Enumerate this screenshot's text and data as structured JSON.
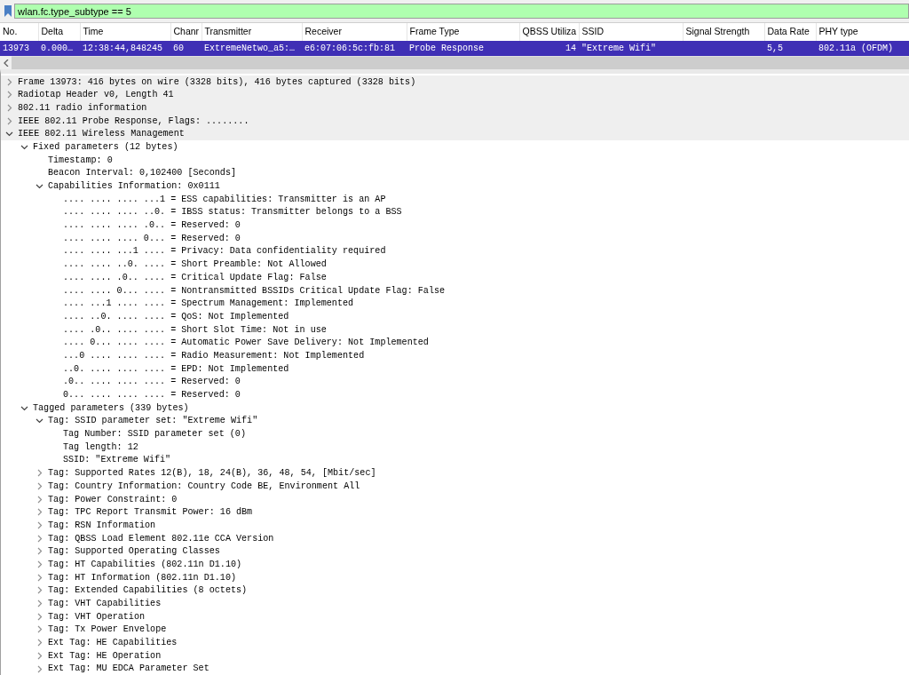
{
  "filter": {
    "value": "wlan.fc.type_subtype == 5"
  },
  "packet_list": {
    "columns": [
      {
        "label": "No.",
        "right_aligned": false
      },
      {
        "label": "Delta",
        "right_aligned": false
      },
      {
        "label": "Time",
        "right_aligned": false
      },
      {
        "label": "Chanr",
        "right_aligned": false
      },
      {
        "label": "Transmitter",
        "right_aligned": false
      },
      {
        "label": "Receiver",
        "right_aligned": false
      },
      {
        "label": "Frame Type",
        "right_aligned": false
      },
      {
        "label": "QBSS Utiliza",
        "right_aligned": true
      },
      {
        "label": "SSID",
        "right_aligned": false
      },
      {
        "label": "Signal Strength"
      },
      {
        "label": "Data Rate",
        "right_aligned": false
      },
      {
        "label": "PHY type",
        "right_aligned": false
      }
    ],
    "rows": [
      {
        "selected": true,
        "cells": [
          "13973",
          "0.000…",
          "12:38:44,848245",
          "60",
          "ExtremeNetwo_a5:…",
          "e6:07:06:5c:fb:81",
          "Probe Response",
          "14",
          "\"Extreme Wifi\"",
          "",
          "5,5",
          "802.11a (OFDM)"
        ]
      }
    ]
  },
  "details": [
    {
      "text": "Frame 13973: 416 bytes on wire (3328 bits), 416 bytes captured (3328 bits)",
      "expanded": false
    },
    {
      "text": "Radiotap Header v0, Length 41",
      "expanded": false
    },
    {
      "text": "802.11 radio information",
      "expanded": false
    },
    {
      "text": "IEEE 802.11 Probe Response, Flags: ........",
      "expanded": false
    },
    {
      "text": "IEEE 802.11 Wireless Management",
      "expanded": true,
      "children": [
        {
          "text": "Fixed parameters (12 bytes)",
          "expanded": true,
          "children": [
            {
              "text": "Timestamp: 0"
            },
            {
              "text": "Beacon Interval: 0,102400 [Seconds]"
            },
            {
              "text": "Capabilities Information: 0x0111",
              "expanded": true,
              "children": [
                {
                  "text": ".... .... .... ...1 = ESS capabilities: Transmitter is an AP"
                },
                {
                  "text": ".... .... .... ..0. = IBSS status: Transmitter belongs to a BSS"
                },
                {
                  "text": ".... .... .... .0.. = Reserved: 0"
                },
                {
                  "text": ".... .... .... 0... = Reserved: 0"
                },
                {
                  "text": ".... .... ...1 .... = Privacy: Data confidentiality required"
                },
                {
                  "text": ".... .... ..0. .... = Short Preamble: Not Allowed"
                },
                {
                  "text": ".... .... .0.. .... = Critical Update Flag: False"
                },
                {
                  "text": ".... .... 0... .... = Nontransmitted BSSIDs Critical Update Flag: False"
                },
                {
                  "text": ".... ...1 .... .... = Spectrum Management: Implemented"
                },
                {
                  "text": ".... ..0. .... .... = QoS: Not Implemented"
                },
                {
                  "text": ".... .0.. .... .... = Short Slot Time: Not in use"
                },
                {
                  "text": ".... 0... .... .... = Automatic Power Save Delivery: Not Implemented"
                },
                {
                  "text": "...0 .... .... .... = Radio Measurement: Not Implemented"
                },
                {
                  "text": "..0. .... .... .... = EPD: Not Implemented"
                },
                {
                  "text": ".0.. .... .... .... = Reserved: 0"
                },
                {
                  "text": "0... .... .... .... = Reserved: 0"
                }
              ]
            }
          ]
        },
        {
          "text": "Tagged parameters (339 bytes)",
          "expanded": true,
          "children": [
            {
              "text": "Tag: SSID parameter set: \"Extreme Wifi\"",
              "expanded": true,
              "children": [
                {
                  "text": "Tag Number: SSID parameter set (0)"
                },
                {
                  "text": "Tag length: 12"
                },
                {
                  "text": "SSID: \"Extreme Wifi\""
                }
              ]
            },
            {
              "text": "Tag: Supported Rates 12(B), 18, 24(B), 36, 48, 54, [Mbit/sec]",
              "expanded": false
            },
            {
              "text": "Tag: Country Information: Country Code BE, Environment All",
              "expanded": false
            },
            {
              "text": "Tag: Power Constraint: 0",
              "expanded": false
            },
            {
              "text": "Tag: TPC Report Transmit Power: 16 dBm",
              "expanded": false
            },
            {
              "text": "Tag: RSN Information",
              "expanded": false
            },
            {
              "text": "Tag: QBSS Load Element 802.11e CCA Version",
              "expanded": false
            },
            {
              "text": "Tag: Supported Operating Classes",
              "expanded": false
            },
            {
              "text": "Tag: HT Capabilities (802.11n D1.10)",
              "expanded": false
            },
            {
              "text": "Tag: HT Information (802.11n D1.10)",
              "expanded": false
            },
            {
              "text": "Tag: Extended Capabilities (8 octets)",
              "expanded": false
            },
            {
              "text": "Tag: VHT Capabilities",
              "expanded": false
            },
            {
              "text": "Tag: VHT Operation",
              "expanded": false
            },
            {
              "text": "Tag: Tx Power Envelope",
              "expanded": false
            },
            {
              "text": "Ext Tag: HE Capabilities",
              "expanded": false
            },
            {
              "text": "Ext Tag: HE Operation",
              "expanded": false
            },
            {
              "text": "Ext Tag: MU EDCA Parameter Set",
              "expanded": false
            }
          ]
        }
      ]
    }
  ]
}
